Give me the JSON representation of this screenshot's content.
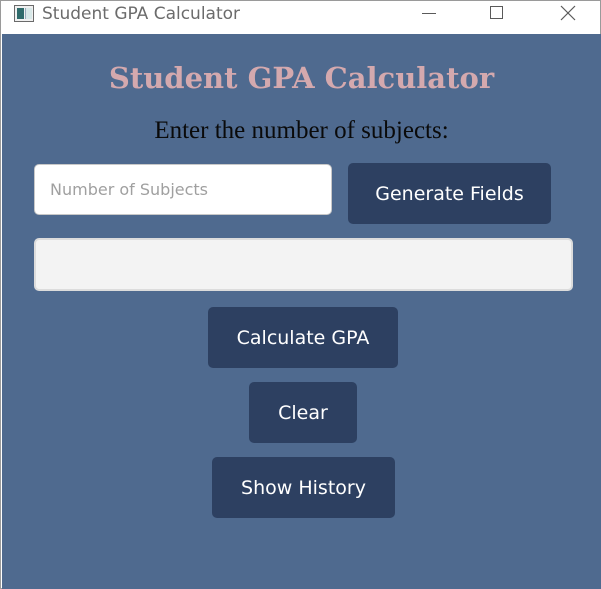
{
  "window": {
    "title": "Student GPA Calculator",
    "icons": [
      "app-icon",
      "minimize-icon",
      "maximize-icon",
      "close-icon"
    ]
  },
  "main": {
    "heading": "Student GPA Calculator",
    "prompt": "Enter the number of subjects:",
    "subjects_input": {
      "value": "",
      "placeholder": "Number of Subjects"
    },
    "generate_button": "Generate Fields",
    "calculate_button": "Calculate GPA",
    "clear_button": "Clear",
    "history_button": "Show History"
  },
  "colors": {
    "background": "#4f6a8f",
    "heading": "#d4a9ae",
    "button": "#2d4061",
    "button_text": "#ffffff",
    "fields_area": "#f3f3f3"
  }
}
